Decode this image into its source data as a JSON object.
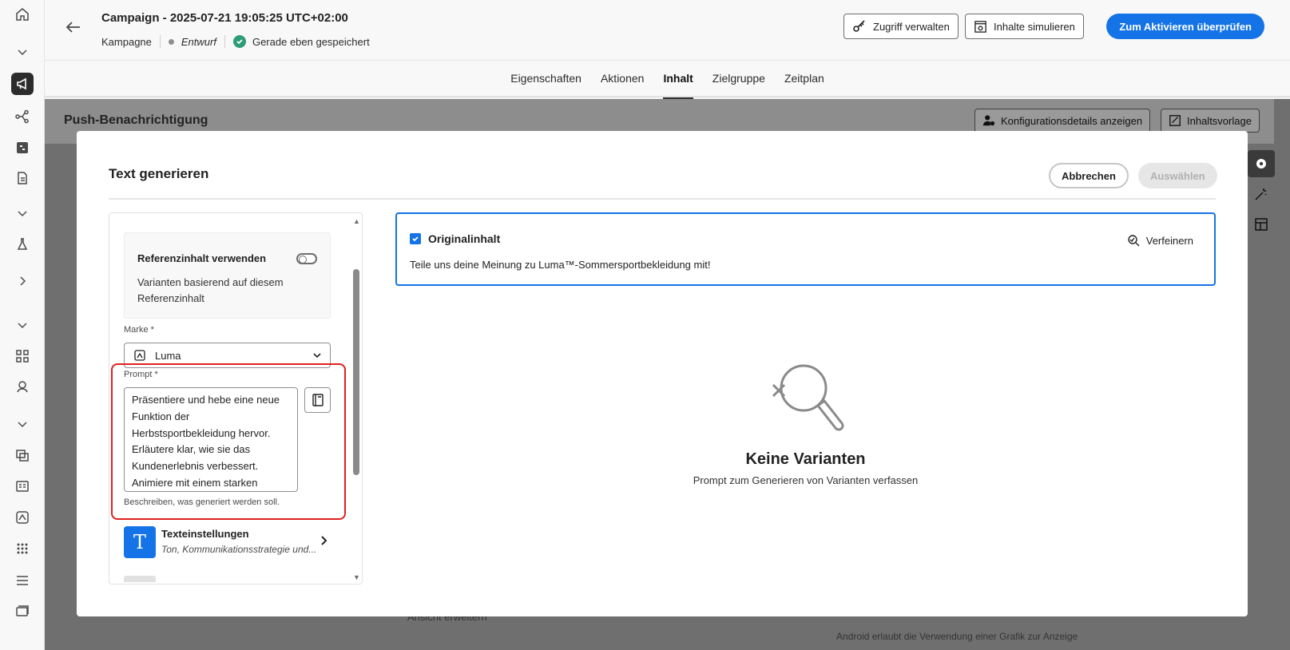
{
  "header": {
    "title": "Campaign - 2025-07-21 19:05:25 UTC+02:00",
    "type": "Kampagne",
    "status": "Entwurf",
    "saved": "Gerade eben gespeichert",
    "manage_access": "Zugriff verwalten",
    "simulate": "Inhalte simulieren",
    "review": "Zum Aktivieren überprüfen"
  },
  "tabs": [
    {
      "label": "Eigenschaften"
    },
    {
      "label": "Aktionen"
    },
    {
      "label": "Inhalt"
    },
    {
      "label": "Zielgruppe"
    },
    {
      "label": "Zeitplan"
    }
  ],
  "background": {
    "section_title": "Push-Benachrichtigung",
    "config_details": "Konfigurationsdetails anzeigen",
    "content_template": "Inhaltsvorlage",
    "expand_view": "Ansicht erweitern",
    "android_note": "Android erlaubt die Verwendung einer Grafik zur Anzeige"
  },
  "modal": {
    "title": "Text generieren",
    "cancel": "Abbrechen",
    "select": "Auswählen",
    "reference": {
      "title": "Referenzinhalt verwenden",
      "description": "Varianten basierend auf diesem Referenzinhalt",
      "enabled": false
    },
    "brand": {
      "label": "Marke",
      "required_mark": "*",
      "value": "Luma"
    },
    "prompt": {
      "label": "Prompt",
      "required_mark": "*",
      "value": "Präsentiere und hebe eine neue Funktion der Herbstsportbekleidung hervor. Erläutere klar, wie sie das Kundenerlebnis verbessert. Animiere mit einem starken Handlungsaufruf zur Interaktion.",
      "help": "Beschreiben, was generiert werden soll."
    },
    "text_settings": {
      "title": "Texteinstellungen",
      "subtitle": "Ton, Kommunikationsstrategie und..."
    },
    "original": {
      "title": "Originalinhalt",
      "checked": true,
      "text": "Teile uns deine Meinung zu Luma™-Sommersportbekleidung mit!",
      "refine": "Verfeinern"
    },
    "empty": {
      "title": "Keine Varianten",
      "subtitle": "Prompt zum Generieren von Varianten verfassen"
    }
  },
  "colors": {
    "accent": "#1473e6",
    "highlight": "#e0201f",
    "saved_check": "#2d9d78"
  }
}
